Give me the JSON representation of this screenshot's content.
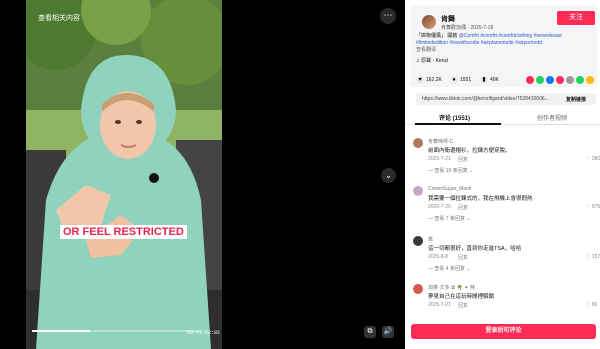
{
  "video": {
    "related_label": "查看相关内容",
    "caption": "OR FEEL RESTRICTED",
    "timecode": "00:41/02:02",
    "progress": 0.34,
    "more_icon": "more-dots-icon",
    "next_icon": "chevron-down-icon"
  },
  "author": {
    "name": "肯舞",
    "subtitle": "肯舞歡加倆 · 2025-7-18",
    "follow_label": "关注",
    "description_prefix": "「搞物優風」 開啟",
    "hashtags": "@Comfrt #comfrt #comfrtclothing #newrelease #limitededition #travelhoodie #airplanemode #airportootd",
    "translate_label": "查看翻译",
    "music": "♫ 原聲 - Kenzi"
  },
  "stats": {
    "likes": "162.2K",
    "comments": "1551",
    "saves": "40K"
  },
  "share_colors": [
    "#fe2c55",
    "#25d366",
    "#1877f2",
    "#fe2c55",
    "#9b9b9b",
    "#25d366",
    "#ffb800"
  ],
  "url": {
    "value": "https://www.tiktok.com/@kenzifigard/video/7528410606...",
    "copy_label": "复制链接"
  },
  "tabs": [
    {
      "label": "评论 (1551)"
    },
    {
      "label": "创作者视频"
    }
  ],
  "comments": [
    {
      "user": "肯舞咪呀-C",
      "text": "前面內衛邊帽衫，拉鍊方便穿脫。",
      "date": "2025-7-21",
      "reply": "回复",
      "likes": "360",
      "more": "查看 19 条回复"
    },
    {
      "user": "CreamSugar_Mami",
      "text": "我需要一個拉鍊式的，我在飛機上會很悶熱",
      "date": "2025-7-20",
      "reply": "回复",
      "likes": "975",
      "more": "查看 7 条回复"
    },
    {
      "user": "喬",
      "text": "這一切都很好，直到你走進TSA，哈哈",
      "date": "2025-8-8",
      "reply": "回复",
      "likes": "157",
      "more": "查看 4 条回复"
    },
    {
      "user": "加菜·文多 ✿ 🌴 ✦ 特",
      "text": "夢見自己在這玩時間裡解鎖",
      "date": "2025-7-21",
      "reply": "回复",
      "likes": "86",
      "more": ""
    }
  ],
  "login_label": "登录后可评论"
}
